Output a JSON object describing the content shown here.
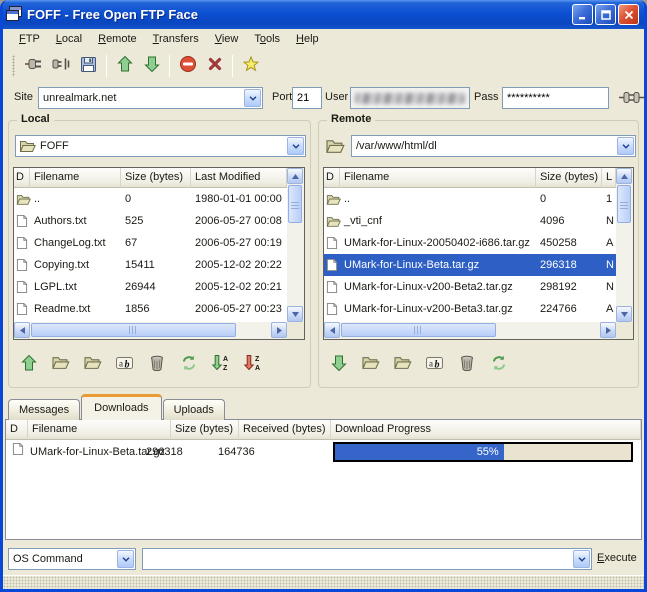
{
  "window": {
    "title": "FOFF - Free Open FTP Face"
  },
  "menu": {
    "items": [
      {
        "label": "FTP",
        "u": 0
      },
      {
        "label": "Local",
        "u": 0
      },
      {
        "label": "Remote",
        "u": 0
      },
      {
        "label": "Transfers",
        "u": 0
      },
      {
        "label": "View",
        "u": 0
      },
      {
        "label": "Tools",
        "u": 1
      },
      {
        "label": "Help",
        "u": 0
      }
    ]
  },
  "toolbar": {
    "buttons": [
      "connect",
      "disconnect",
      "save",
      "upload",
      "download",
      "stop",
      "abort",
      "favorites"
    ]
  },
  "connection": {
    "site_label": "Site",
    "site_value": "unrealmark.net",
    "port_label": "Port",
    "port_value": "21",
    "user_label": "User",
    "user_value_redacted": true,
    "pass_label": "Pass",
    "pass_value": "**********"
  },
  "local": {
    "title": "Local",
    "path": "FOFF",
    "columns": [
      "D",
      "Filename",
      "Size (bytes)",
      "Last Modified"
    ],
    "rows": [
      {
        "type": "folder",
        "name": "..",
        "size": "0",
        "modified": "1980-01-01 00:00"
      },
      {
        "type": "file",
        "name": "Authors.txt",
        "size": "525",
        "modified": "2006-05-27 00:08"
      },
      {
        "type": "file",
        "name": "ChangeLog.txt",
        "size": "67",
        "modified": "2006-05-27 00:19"
      },
      {
        "type": "file",
        "name": "Copying.txt",
        "size": "15411",
        "modified": "2005-12-02 20:22"
      },
      {
        "type": "file",
        "name": "LGPL.txt",
        "size": "26944",
        "modified": "2005-12-02 20:21"
      },
      {
        "type": "file",
        "name": "Readme.txt",
        "size": "1856",
        "modified": "2006-05-27 00:23"
      }
    ],
    "actions": [
      "upload",
      "open-folder",
      "new-folder",
      "rename",
      "delete",
      "refresh",
      "sort-ascending",
      "sort-descending"
    ]
  },
  "remote": {
    "title": "Remote",
    "path": "/var/www/html/dl",
    "columns": [
      "D",
      "Filename",
      "Size (bytes)",
      "L"
    ],
    "rows": [
      {
        "type": "folder",
        "name": "..",
        "size": "0",
        "modified": "1"
      },
      {
        "type": "folder",
        "name": "_vti_cnf",
        "size": "4096",
        "modified": "N"
      },
      {
        "type": "file",
        "name": "UMark-for-Linux-20050402-i686.tar.gz",
        "size": "450258",
        "modified": "A"
      },
      {
        "type": "file",
        "name": "UMark-for-Linux-Beta.tar.gz",
        "size": "296318",
        "modified": "N",
        "selected": true
      },
      {
        "type": "file",
        "name": "UMark-for-Linux-v200-Beta2.tar.gz",
        "size": "298192",
        "modified": "N"
      },
      {
        "type": "file",
        "name": "UMark-for-Linux-v200-Beta3.tar.gz",
        "size": "224766",
        "modified": "A"
      }
    ],
    "actions": [
      "download",
      "open-folder",
      "new-folder",
      "rename",
      "delete",
      "refresh"
    ]
  },
  "tabs": {
    "items": [
      "Messages",
      "Downloads",
      "Uploads"
    ],
    "active": "Downloads"
  },
  "downloads": {
    "columns": [
      "D",
      "Filename",
      "Size (bytes)",
      "Received (bytes)",
      "Download Progress"
    ],
    "rows": [
      {
        "type": "file",
        "name": "UMark-for-Linux-Beta.tar.gz",
        "size": "296318",
        "received": "164736",
        "progress_percent": 55,
        "progress_label": "55%"
      }
    ]
  },
  "command_bar": {
    "selector_value": "OS Command",
    "command_value": "",
    "execute": {
      "label": "Execute",
      "u": 0
    }
  },
  "colors": {
    "selection": "#2E5FC4",
    "progress_fill": "#3565C8",
    "titlebar_blue": "#0D50D2",
    "panel_bg": "#ECE9D8",
    "active_tab_accent": "#E89B35"
  }
}
